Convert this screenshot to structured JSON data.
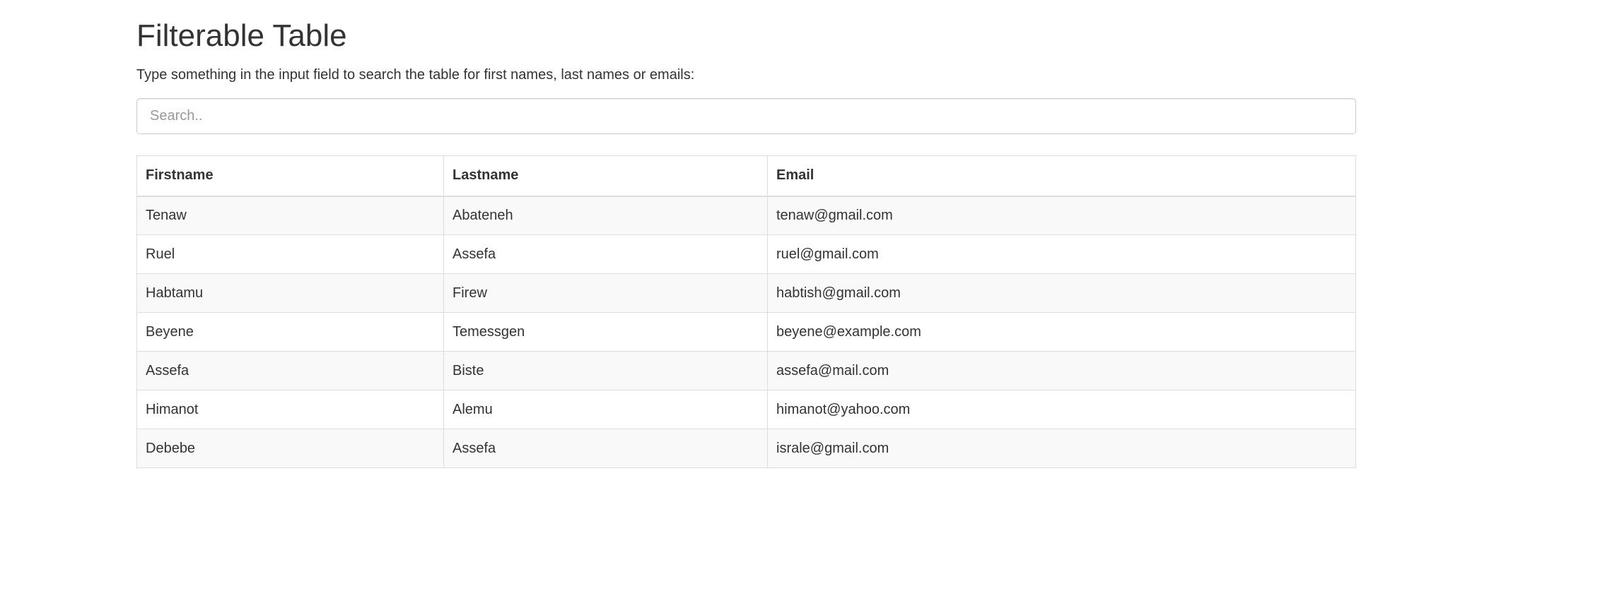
{
  "page": {
    "title": "Filterable Table",
    "intro": "Type something in the input field to search the table for first names, last names or emails:"
  },
  "search": {
    "placeholder": "Search..",
    "value": ""
  },
  "table": {
    "headers": [
      "Firstname",
      "Lastname",
      "Email"
    ],
    "rows": [
      [
        "Tenaw",
        "Abateneh",
        "tenaw@gmail.com"
      ],
      [
        "Ruel",
        "Assefa",
        "ruel@gmail.com"
      ],
      [
        "Habtamu",
        "Firew",
        "habtish@gmail.com"
      ],
      [
        "Beyene",
        "Temessgen",
        "beyene@example.com"
      ],
      [
        "Assefa",
        "Biste",
        "assefa@mail.com"
      ],
      [
        "Himanot",
        "Alemu",
        "himanot@yahoo.com"
      ],
      [
        "Debebe",
        "Assefa",
        "israle@gmail.com"
      ]
    ]
  },
  "colors": {
    "text": "#333333",
    "border": "#dddddd",
    "stripe": "#f9f9f9",
    "input_border": "#cccccc"
  }
}
